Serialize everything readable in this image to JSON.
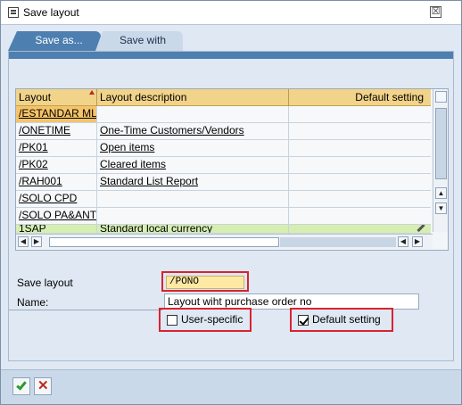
{
  "window": {
    "title": "Save layout",
    "close_glyph": "☒"
  },
  "tabs": [
    {
      "label": "Save as..."
    },
    {
      "label": "Save with"
    }
  ],
  "grid": {
    "columns": [
      "Layout",
      "Layout description",
      "Default setting"
    ],
    "rows": [
      {
        "layout": "/ESTANDAR ML",
        "description": ""
      },
      {
        "layout": "/ONETIME",
        "description": "One-Time Customers/Vendors"
      },
      {
        "layout": "/PK01",
        "description": "Open items"
      },
      {
        "layout": "/PK02",
        "description": "Cleared items"
      },
      {
        "layout": "/RAH001",
        "description": "Standard List Report"
      },
      {
        "layout": "/SOLO CPD",
        "description": ""
      },
      {
        "layout": "/SOLO PA&ANT",
        "description": ""
      },
      {
        "layout": "1SAP",
        "description": "Standard local currency"
      }
    ]
  },
  "form": {
    "save_layout_label": "Save layout",
    "save_layout_value": "/PONO",
    "name_label": "Name:",
    "name_value": "Layout wiht purchase order no",
    "user_specific_label": "User-specific",
    "user_specific_checked": false,
    "default_setting_label": "Default setting",
    "default_setting_checked": true
  },
  "icons": {
    "confirm": "check-icon",
    "cancel": "cancel-icon"
  },
  "colors": {
    "header_bg": "#f2d38a",
    "selected_row": "#f5c46a",
    "highlight_row": "#d6efb0",
    "callout_border": "#d9232f",
    "input_bg": "#fde9a4"
  }
}
